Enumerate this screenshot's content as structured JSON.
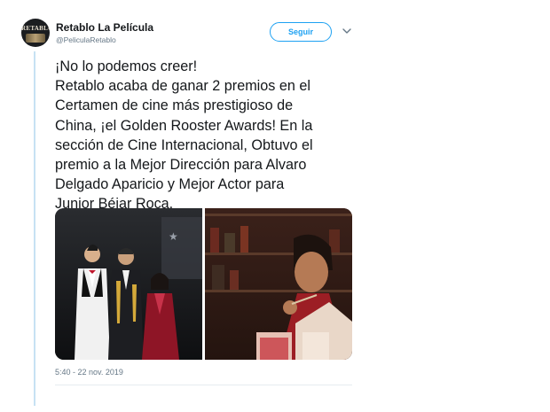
{
  "header": {
    "avatar_text": "RETABLO",
    "display_name": "Retablo La Película",
    "handle": "@PeliculaRetablo",
    "follow_label": "Seguir"
  },
  "tweet": {
    "lines": [
      "¡No lo podemos creer!",
      "Retablo acaba de ganar 2 premios en el",
      "Certamen de cine más prestigioso de",
      "China, ¡el Golden Rooster Awards! En la",
      "sección de Cine Internacional, Obtuvo el",
      "premio a la Mejor Dirección para Alvaro",
      "Delgado Aparicio y Mejor Actor para",
      "Junior Béjar Roca."
    ],
    "timestamp": "5:40 - 22 nov. 2019"
  },
  "colors": {
    "accent": "#1da1f2",
    "thread_line": "#c7e2f3",
    "muted": "#657786"
  },
  "icons": [
    "chevron-down-icon"
  ]
}
